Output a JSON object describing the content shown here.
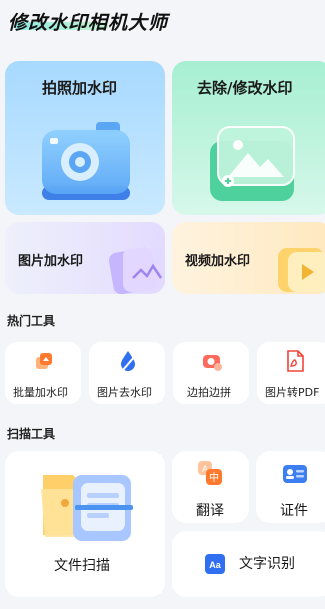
{
  "app": {
    "title": "修改水印相机大师"
  },
  "cards": {
    "photo": {
      "label": "拍照加水印"
    },
    "remove": {
      "label": "去除/修改水印"
    },
    "image": {
      "label": "图片加水印"
    },
    "video": {
      "label": "视频加水印"
    }
  },
  "hot_tools": {
    "title": "热门工具",
    "items": [
      {
        "label": "批量加水印",
        "icon": "batch-icon"
      },
      {
        "label": "图片去水印",
        "icon": "drop-icon"
      },
      {
        "label": "边拍边拼",
        "icon": "camera-stitch-icon"
      },
      {
        "label": "图片转PDF",
        "icon": "pdf-icon"
      }
    ]
  },
  "scan_tools": {
    "title": "扫描工具",
    "doc_scan": {
      "label": "文件扫描"
    },
    "translate": {
      "label": "翻译",
      "icon_text": "中"
    },
    "certificate": {
      "label": "证件"
    },
    "ocr": {
      "label": "文字识别",
      "icon_text": "Aa"
    }
  },
  "colors": {
    "blue_accent": "#4a93f0",
    "green_accent": "#3cc48a",
    "orange_accent": "#ff8a3c",
    "red_accent": "#ff5a4f"
  }
}
